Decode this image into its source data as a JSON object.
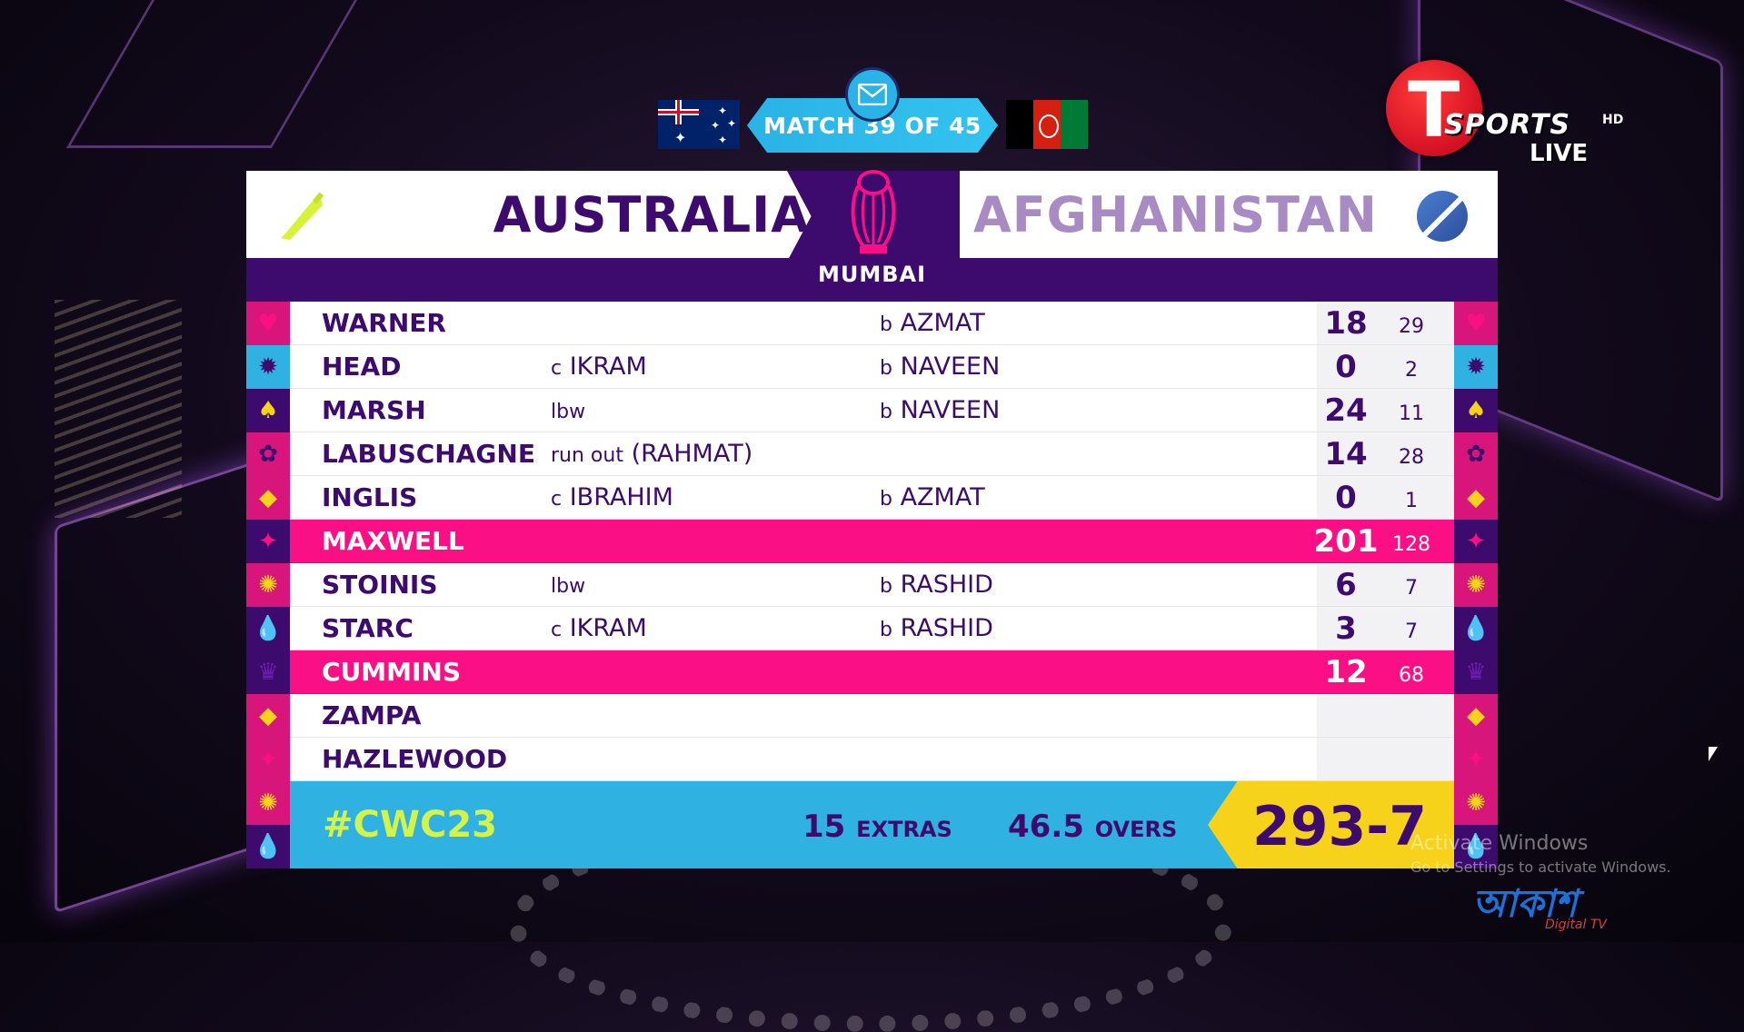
{
  "header": {
    "match_label": "MATCH 39 OF 45",
    "team_batting": "AUSTRALIA",
    "team_bowling": "AFGHANISTAN",
    "venue": "MUMBAI"
  },
  "broadcaster": {
    "logo_letter": "T",
    "logo_word": "SPORTS",
    "hd": "HD",
    "live": "LIVE"
  },
  "colors": {
    "primary_purple": "#3d0a6e",
    "highlight_pink": "#fb0f84",
    "footer_blue": "#2fb1e2",
    "total_yellow": "#f6d21a",
    "hashtag_green": "#d3f24a"
  },
  "batters": [
    {
      "name": "WARNER",
      "dismissal_pre": "",
      "dismissal": "",
      "bowler_pre": "b",
      "bowler": "AZMAT",
      "runs": "18",
      "balls": "29",
      "highlight": false,
      "icon_left": "lotus-icon",
      "icon_right": "lotus-icon"
    },
    {
      "name": "HEAD",
      "dismissal_pre": "c",
      "dismissal": "IKRAM",
      "bowler_pre": "b",
      "bowler": "NAVEEN",
      "runs": "0",
      "balls": "2",
      "highlight": false,
      "icon_left": "sun-icon",
      "icon_right": "sun-icon"
    },
    {
      "name": "MARSH",
      "dismissal_pre": "lbw",
      "dismissal": "",
      "bowler_pre": "b",
      "bowler": "NAVEEN",
      "runs": "24",
      "balls": "11",
      "highlight": false,
      "icon_left": "bell-icon",
      "icon_right": "bell-icon"
    },
    {
      "name": "LABUSCHAGNE",
      "dismissal_pre": "run out",
      "dismissal": "(RAHMAT)",
      "bowler_pre": "",
      "bowler": "",
      "runs": "14",
      "balls": "28",
      "highlight": false,
      "icon_left": "flower-icon",
      "icon_right": "flower-icon"
    },
    {
      "name": "INGLIS",
      "dismissal_pre": "c",
      "dismissal": "IBRAHIM",
      "bowler_pre": "b",
      "bowler": "AZMAT",
      "runs": "0",
      "balls": "1",
      "highlight": false,
      "icon_left": "diamond-icon",
      "icon_right": "diamond-icon"
    },
    {
      "name": "MAXWELL",
      "dismissal_pre": "",
      "dismissal": "",
      "bowler_pre": "",
      "bowler": "",
      "runs": "201",
      "balls": "128",
      "highlight": true,
      "icon_left": "star-icon",
      "icon_right": "star-icon"
    },
    {
      "name": "STOINIS",
      "dismissal_pre": "lbw",
      "dismissal": "",
      "bowler_pre": "b",
      "bowler": "RASHID",
      "runs": "6",
      "balls": "7",
      "highlight": false,
      "icon_left": "sunburst-icon",
      "icon_right": "sunburst-icon"
    },
    {
      "name": "STARC",
      "dismissal_pre": "c",
      "dismissal": "IKRAM",
      "bowler_pre": "b",
      "bowler": "RASHID",
      "runs": "3",
      "balls": "7",
      "highlight": false,
      "icon_left": "drop-icon",
      "icon_right": "drop-icon"
    },
    {
      "name": "CUMMINS",
      "dismissal_pre": "",
      "dismissal": "",
      "bowler_pre": "",
      "bowler": "",
      "runs": "12",
      "balls": "68",
      "highlight": true,
      "icon_left": "crown-icon",
      "icon_right": "crown-icon"
    },
    {
      "name": "ZAMPA",
      "dismissal_pre": "",
      "dismissal": "",
      "bowler_pre": "",
      "bowler": "",
      "runs": "",
      "balls": "",
      "highlight": false,
      "icon_left": "diamond-icon",
      "icon_right": "diamond-icon"
    },
    {
      "name": "HAZLEWOOD",
      "dismissal_pre": "",
      "dismissal": "",
      "bowler_pre": "",
      "bowler": "",
      "runs": "",
      "balls": "",
      "highlight": false,
      "icon_left": "star-icon",
      "icon_right": "star-icon"
    }
  ],
  "footer": {
    "hashtag": "#CWC23",
    "extras_value": "15",
    "extras_label": "EXTRAS",
    "overs_value": "46.5",
    "overs_label": "OVERS",
    "total": "293-7"
  },
  "overlay": {
    "activate_title": "Activate Windows",
    "activate_sub": "Go to Settings to activate Windows.",
    "channel_logo": "আকাশ",
    "channel_sub": "Digital TV"
  }
}
